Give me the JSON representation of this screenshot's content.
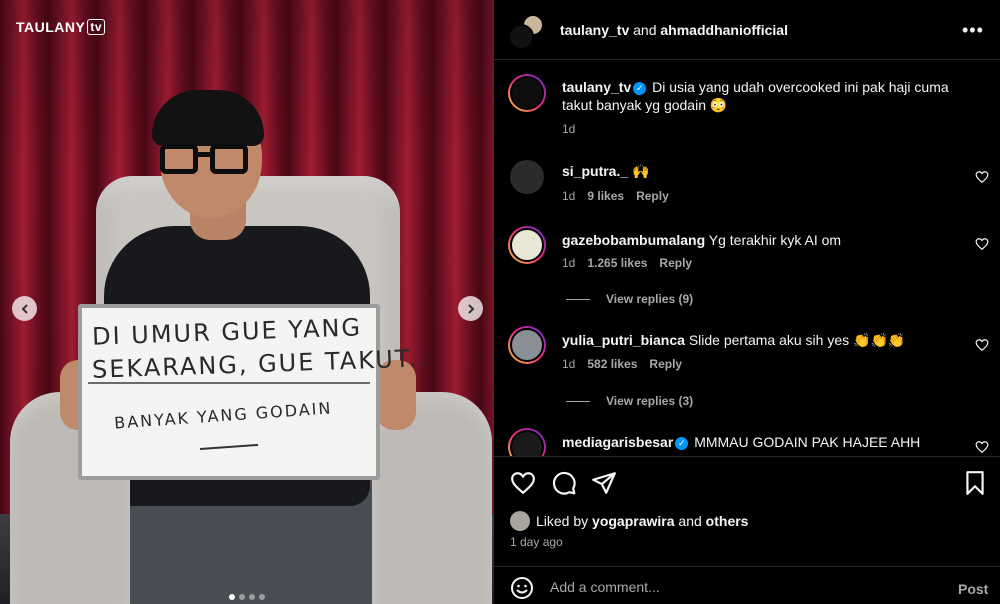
{
  "photo": {
    "logo_text": "TAULANY",
    "logo_badge": "tv",
    "board_line1": "DI UMUR GUE YANG",
    "board_line2": "SEKARANG, GUE TAKUT..",
    "board_line3": "BANYAK YANG GODAIN",
    "carousel_count": 4,
    "carousel_active": 1
  },
  "header": {
    "user1": "taulany_tv",
    "and": "and",
    "user2": "ahmaddhaniofficial",
    "more_icon": "more-horizontal-icon"
  },
  "caption": {
    "username": "taulany_tv",
    "text": "Di usia yang udah overcooked ini pak haji cuma takut banyak yg godain 😳",
    "time": "1d"
  },
  "comments": [
    {
      "username": "si_putra._",
      "text": "🙌",
      "time": "1d",
      "likes": "9 likes",
      "reply": "Reply"
    },
    {
      "username": "gazebobambumalang",
      "text": "Yg terakhir kyk AI om",
      "time": "1d",
      "likes": "1.265 likes",
      "reply": "Reply",
      "view_replies": "View replies (9)"
    },
    {
      "username": "yulia_putri_bianca",
      "text": "Slide pertama aku sih yes 👏👏👏",
      "time": "1d",
      "likes": "582 likes",
      "reply": "Reply",
      "view_replies": "View replies (3)"
    },
    {
      "username": "mediagarisbesar",
      "text": "MMMAU GODAIN PAK HAJEE AHH"
    }
  ],
  "actions": {
    "liked_prefix": "Liked by",
    "liked_user": "yogaprawira",
    "liked_and": "and",
    "liked_others": "others",
    "time": "1 day ago"
  },
  "add_comment": {
    "placeholder": "Add a comment...",
    "post_label": "Post"
  },
  "colors": {
    "background": "#000000",
    "verified": "#0095f6",
    "muted": "#a8a8a8"
  }
}
